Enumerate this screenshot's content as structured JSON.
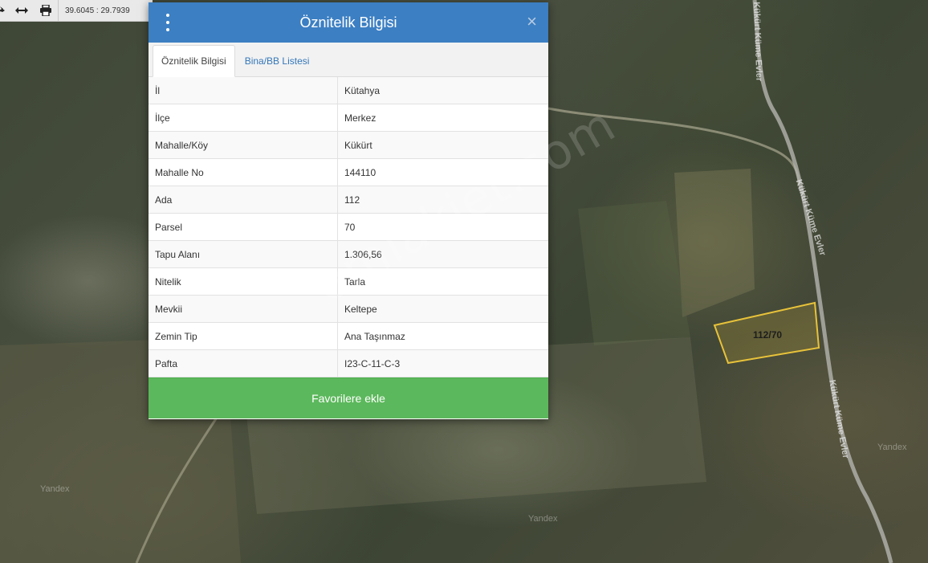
{
  "toolbar": {
    "coords": "39.6045 : 29.7939",
    "icons": [
      "star-icon",
      "pan-arrows-icon",
      "print-icon"
    ]
  },
  "dialog": {
    "title": "Öznitelik Bilgisi",
    "close_symbol": "×",
    "tabs": [
      {
        "label": "Öznitelik Bilgisi",
        "active": true
      },
      {
        "label": "Bina/BB Listesi",
        "active": false
      }
    ],
    "rows": [
      {
        "key": "İl",
        "value": "Kütahya"
      },
      {
        "key": "İlçe",
        "value": "Merkez"
      },
      {
        "key": "Mahalle/Köy",
        "value": "Kükürt"
      },
      {
        "key": "Mahalle No",
        "value": "144110"
      },
      {
        "key": "Ada",
        "value": "112"
      },
      {
        "key": "Parsel",
        "value": "70"
      },
      {
        "key": "Tapu Alanı",
        "value": "1.306,56"
      },
      {
        "key": "Nitelik",
        "value": "Tarla"
      },
      {
        "key": "Mevkii",
        "value": "Keltepe"
      },
      {
        "key": "Zemin Tip",
        "value": "Ana Taşınmaz"
      },
      {
        "key": "Pafta",
        "value": "I23-C-11-C-3"
      }
    ],
    "favorite_button": "Favorilere ekle"
  },
  "map": {
    "parcel_label": "112/70",
    "road_label_1": "Kükürt Küme Evler",
    "road_label_2": "Kükürt Küme Evler",
    "road_label_3": "Kükürt Küme Evler",
    "attribution": "Yandex",
    "watermark": "emlakjet.com",
    "parcel_color": "#e8c23a"
  }
}
